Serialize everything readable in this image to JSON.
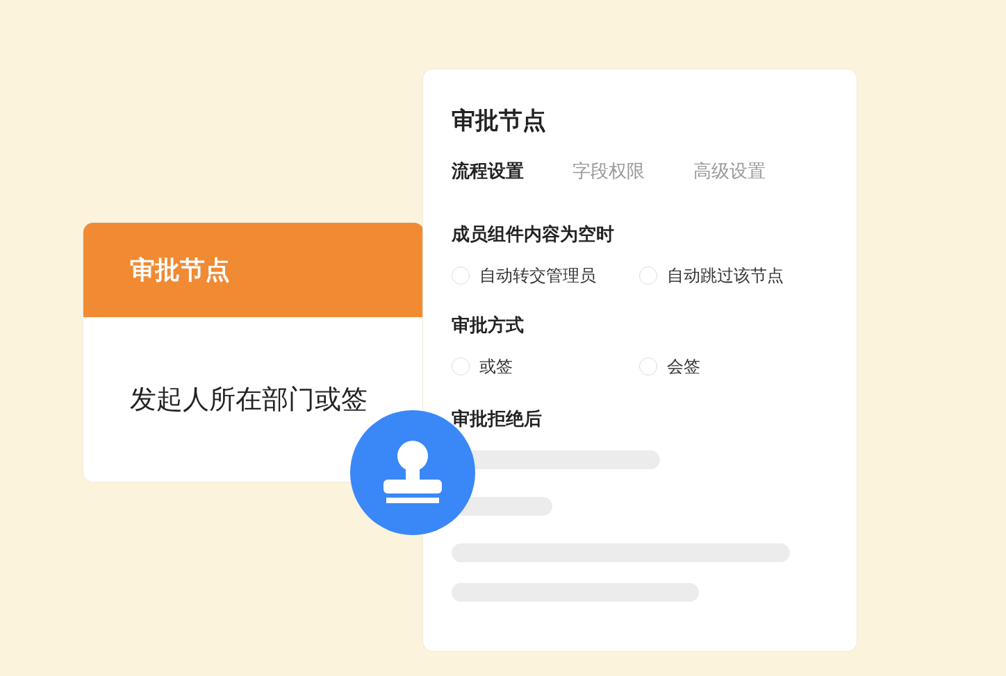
{
  "node_card": {
    "title": "审批节点",
    "subtitle": "发起人所在部门或签"
  },
  "panel": {
    "title": "审批节点",
    "tabs": [
      {
        "label": "流程设置",
        "selected": true
      },
      {
        "label": "字段权限",
        "selected": false
      },
      {
        "label": "高级设置",
        "selected": false
      }
    ],
    "sections": [
      {
        "heading": "成员组件内容为空时",
        "options": [
          {
            "label": "自动转交管理员",
            "selected": false
          },
          {
            "label": "自动跳过该节点",
            "selected": false
          }
        ]
      },
      {
        "heading": "审批方式",
        "options": [
          {
            "label": "或签",
            "selected": false
          },
          {
            "label": "会签",
            "selected": false
          }
        ]
      },
      {
        "heading": "审批拒绝后"
      }
    ]
  }
}
